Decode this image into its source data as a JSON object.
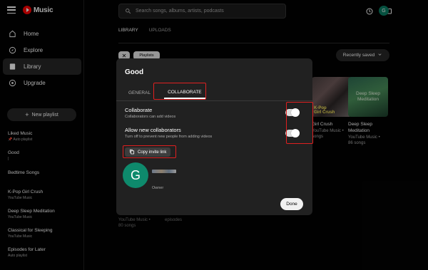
{
  "app": {
    "logo_text": "Music"
  },
  "nav": [
    {
      "label": "Home",
      "icon": "home-icon"
    },
    {
      "label": "Explore",
      "icon": "compass-icon"
    },
    {
      "label": "Library",
      "icon": "library-icon"
    },
    {
      "label": "Upgrade",
      "icon": "upgrade-icon"
    }
  ],
  "new_playlist": "New playlist",
  "playlists": [
    {
      "title": "Liked Music",
      "sub": "Auto playlist"
    },
    {
      "title": "Good",
      "sub": "\u0000"
    },
    {
      "title": "Bedtime Songs",
      "sub": ""
    },
    {
      "title": "K-Pop Girl Crush",
      "sub": "YouTube Music"
    },
    {
      "title": "Deep Sleep Meditation",
      "sub": "YouTube Music"
    },
    {
      "title": "Classical for Sleeping",
      "sub": "YouTube Music"
    },
    {
      "title": "Episodes for Later",
      "sub": "Auto playlist"
    }
  ],
  "search": {
    "placeholder": "Search songs, albums, artists, podcasts"
  },
  "main_tabs": [
    "LIBRARY",
    "UPLOADS"
  ],
  "chips": {
    "close": "✕",
    "playlists": "Playlists"
  },
  "sort": "Recently saved",
  "cards": {
    "kpop": {
      "thumb_label": "K-Pop\nGirl Crush",
      "title": "Girl Crush",
      "sub1": "YouTube Music •",
      "sub2": "songs"
    },
    "deep": {
      "thumb_label": "Deep Sleep\nMeditation",
      "title1": "Deep Sleep",
      "title2": "Meditation",
      "sub1": "YouTube Music •",
      "sub2": "86 songs"
    }
  },
  "behind_modal": {
    "l1": "YouTube Music •",
    "l2": "80 songs",
    "r1": "episodes"
  },
  "modal": {
    "title": "Good",
    "tab_general": "GENERAL",
    "tab_collaborate": "COLLABORATE",
    "collaborate_title": "Collaborate",
    "collaborate_sub": "Collaborators can add videos",
    "allow_title": "Allow new collaborators",
    "allow_sub": "Turn off to prevent new people from adding videos",
    "copy_link": "Copy invite link",
    "owner_initial": "G",
    "owner_role": "Owner",
    "done": "Done"
  },
  "user_initial": "G",
  "toggles": {
    "collaborate": true,
    "allow_new": true
  },
  "colors": {
    "accent_red": "#ff0000",
    "highlight": "#e02020",
    "avatar": "#0e8a6c"
  }
}
